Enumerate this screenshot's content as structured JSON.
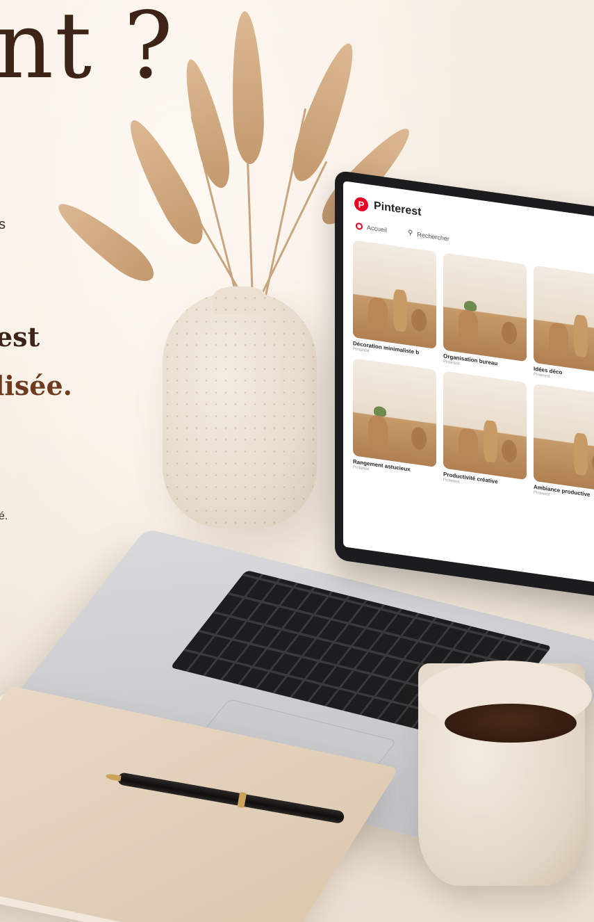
{
  "headline": "nt ?",
  "side_text": {
    "line1": "s",
    "line2": "est",
    "line3": "lisée.",
    "line4": "",
    "line5": "é."
  },
  "laptop": {
    "app_name": "Pinterest",
    "nav": {
      "home_label": "Accueil",
      "search_label": "Rechercher"
    },
    "pins": [
      {
        "title": "Décoration minimaliste b",
        "sub": "Pinterest"
      },
      {
        "title": "Organisation bureau",
        "sub": "Pinterest"
      },
      {
        "title": "Idées déco",
        "sub": "Pinterest"
      },
      {
        "title": "Rangement astucieux",
        "sub": "Pinterest"
      },
      {
        "title": "Productivité créative",
        "sub": "Pinterest"
      },
      {
        "title": "Ambiance productive",
        "sub": "Pinterest"
      }
    ]
  },
  "icons": {
    "logo": "pinterest-logo-icon",
    "home": "home-icon",
    "search": "search-icon"
  },
  "colors": {
    "brand": "#e60023",
    "headline": "#3e2417",
    "accent_text": "#6f3a1e"
  }
}
